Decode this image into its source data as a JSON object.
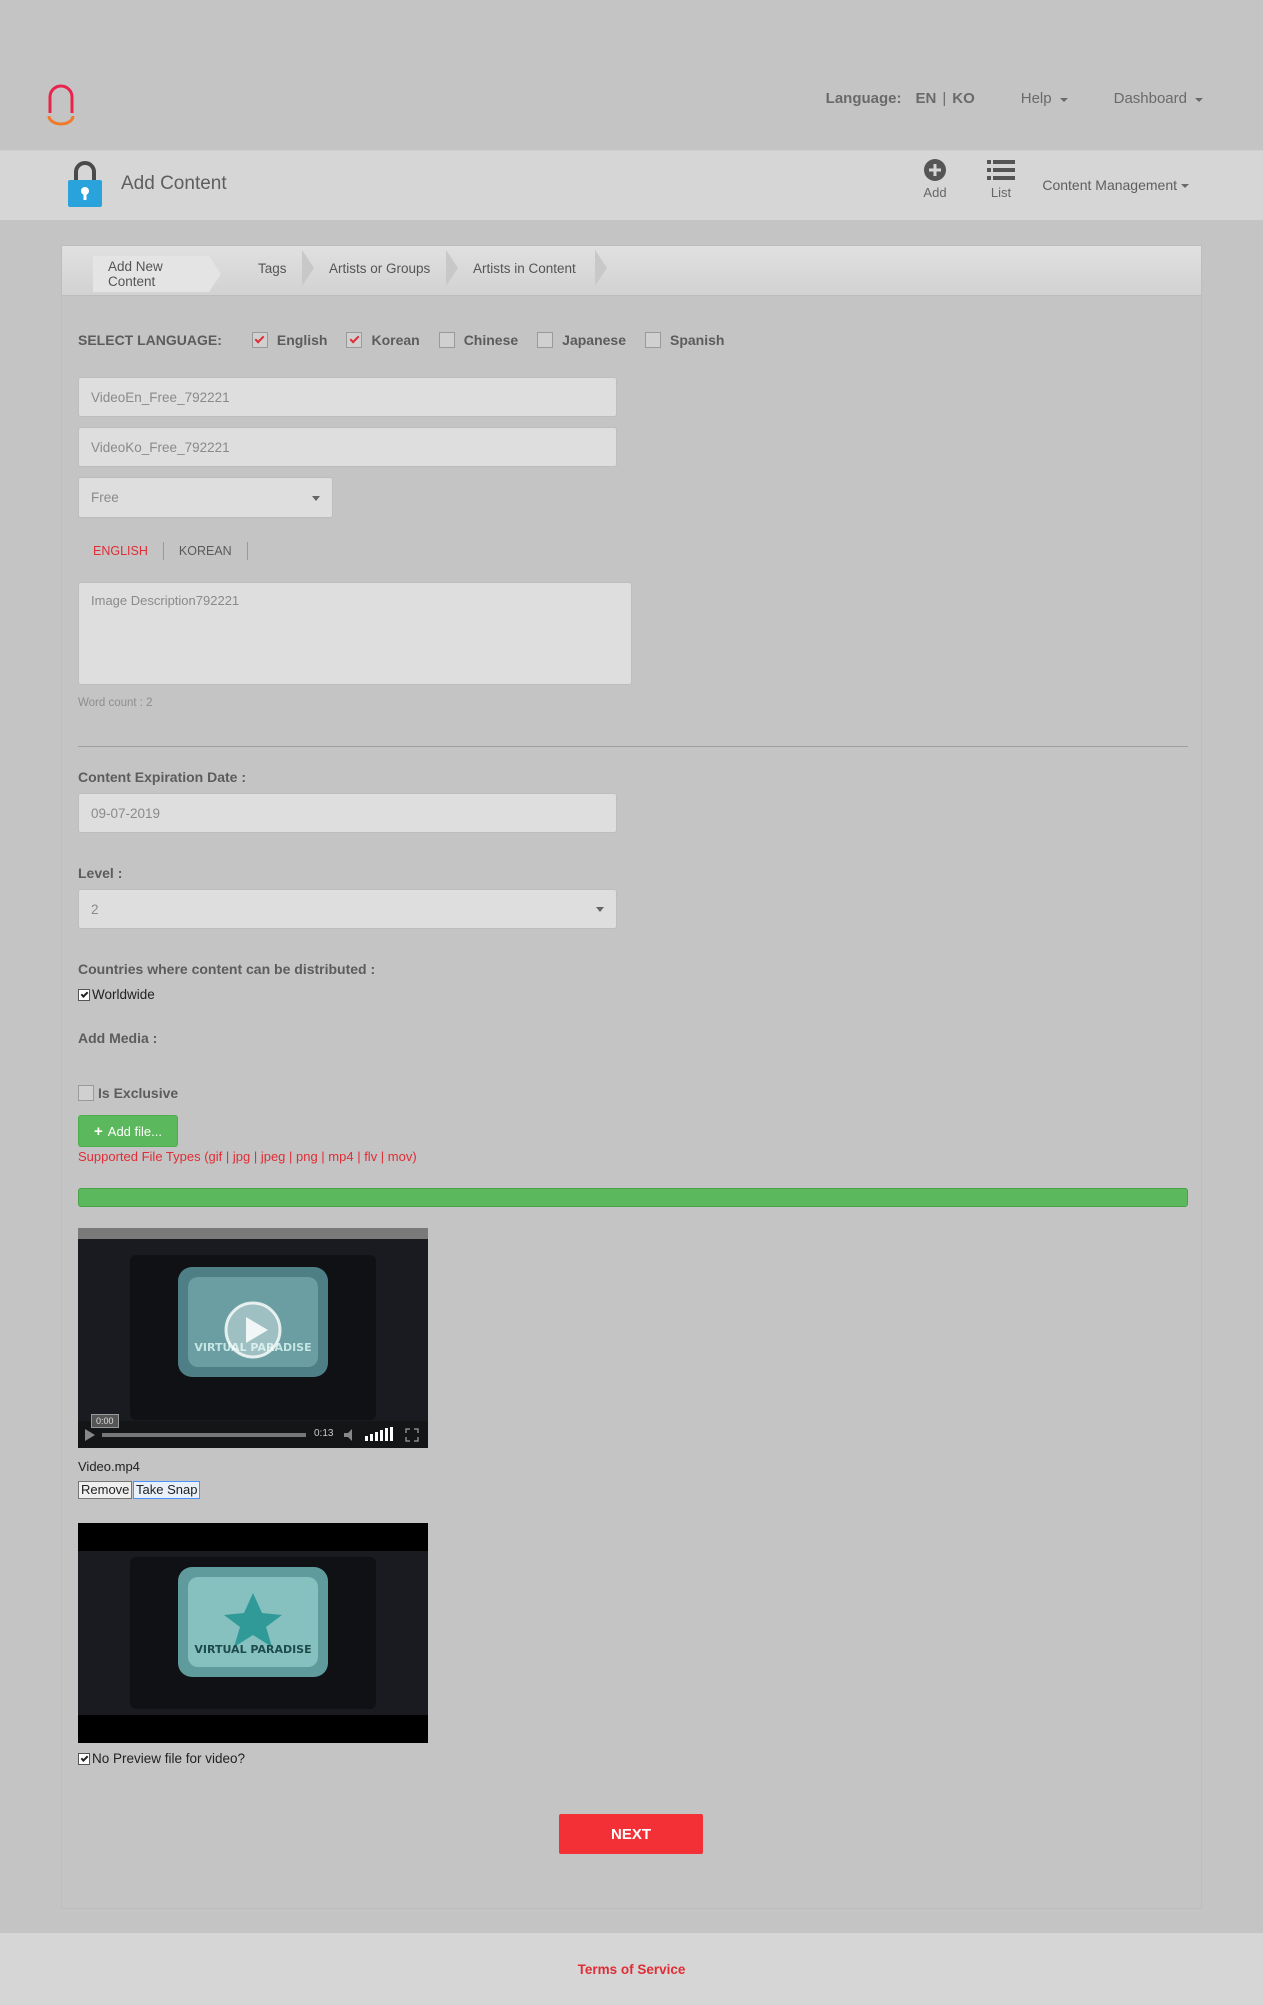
{
  "header": {
    "language_label": "Language:",
    "languages": [
      "EN",
      "KO"
    ],
    "language_separator": "|",
    "help_label": "Help",
    "dashboard_label": "Dashboard"
  },
  "subheader": {
    "title": "Add Content",
    "add_label": "Add",
    "list_label": "List",
    "content_management_label": "Content Management"
  },
  "wizard": {
    "steps": [
      "Add New Content",
      "Tags",
      "Artists or Groups",
      "Artists in Content"
    ],
    "active_step": "Add New Content"
  },
  "form": {
    "select_language_label": "SELECT LANGUAGE:",
    "languages": [
      {
        "label": "English",
        "checked": true
      },
      {
        "label": "Korean",
        "checked": true
      },
      {
        "label": "Chinese",
        "checked": false
      },
      {
        "label": "Japanese",
        "checked": false
      },
      {
        "label": "Spanish",
        "checked": false
      }
    ],
    "title_en_value": "VideoEn_Free_792221",
    "title_ko_value": "VideoKo_Free_792221",
    "pricing_value": "Free",
    "description_tabs": [
      "ENGLISH",
      "KOREAN"
    ],
    "description_active_tab": "ENGLISH",
    "description_value": "Image Description792221",
    "word_count": "Word count : 2",
    "expiration_label": "Content Expiration Date :",
    "expiration_value": "09-07-2019",
    "level_label": "Level :",
    "level_value": "2",
    "countries_label": "Countries where content can be distributed :",
    "worldwide_label": "Worldwide",
    "worldwide_checked": true,
    "add_media_label": "Add Media :",
    "exclusive_label": "Is Exclusive",
    "exclusive_checked": false,
    "add_file_label": "Add file...",
    "supported_types": "Supported File Types (gif | jpg | jpeg | png | mp4 | flv | mov)",
    "upload_progress": 1.0,
    "video": {
      "current_time": "0:00",
      "duration": "0:13",
      "overlay_text": "VIRTUAL PARADISE",
      "file_name": "Video.mp4"
    },
    "remove_label": "Remove",
    "take_snap_label": "Take Snap",
    "snapshot_overlay_text": "VIRTUAL PARADISE",
    "no_preview_label": "No Preview file for video?",
    "no_preview_checked": true,
    "next_label": "NEXT"
  },
  "footer": {
    "terms_label": "Terms of Service"
  },
  "colors": {
    "accent_red": "#e02d35",
    "success_green": "#5cb85c",
    "next_button": "#f23035",
    "lock_blue": "#2aa3dd"
  }
}
